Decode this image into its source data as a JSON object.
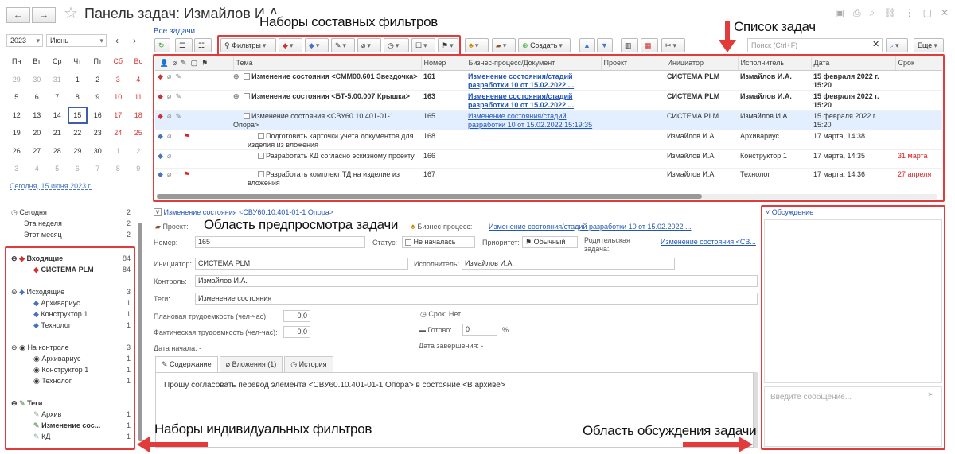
{
  "window": {
    "title": "Панель задач: Измайлов И.А."
  },
  "calendar": {
    "year": "2023",
    "month": "Июнь",
    "weekdays": [
      "Пн",
      "Вт",
      "Ср",
      "Чт",
      "Пт",
      "Сб",
      "Вс"
    ],
    "rows": [
      [
        "29",
        "30",
        "31",
        "1",
        "2",
        "3",
        "4"
      ],
      [
        "5",
        "6",
        "7",
        "8",
        "9",
        "10",
        "11"
      ],
      [
        "12",
        "13",
        "14",
        "15",
        "16",
        "17",
        "18"
      ],
      [
        "19",
        "20",
        "21",
        "22",
        "23",
        "24",
        "25"
      ],
      [
        "26",
        "27",
        "28",
        "29",
        "30",
        "1",
        "2"
      ],
      [
        "3",
        "4",
        "5",
        "6",
        "7",
        "8",
        "9"
      ]
    ],
    "today_link": "Сегодня, 15 июня 2023 г."
  },
  "filters": {
    "periods": [
      {
        "label": "Сегодня",
        "count": "2"
      },
      {
        "label": "Эта неделя",
        "count": "2"
      },
      {
        "label": "Этот месяц",
        "count": "2"
      }
    ],
    "incoming": {
      "label": "Входящие",
      "count": "84",
      "items": [
        {
          "label": "СИСТЕМА PLM",
          "count": "84"
        }
      ]
    },
    "outgoing": {
      "label": "Исходящие",
      "count": "3",
      "items": [
        {
          "label": "Архивариус",
          "count": "1"
        },
        {
          "label": "Конструктор 1",
          "count": "1"
        },
        {
          "label": "Технолог",
          "count": "1"
        }
      ]
    },
    "control": {
      "label": "На контроле",
      "count": "3",
      "items": [
        {
          "label": "Архивариус",
          "count": "1"
        },
        {
          "label": "Конструктор 1",
          "count": "1"
        },
        {
          "label": "Технолог",
          "count": "1"
        }
      ]
    },
    "tags": {
      "label": "Теги",
      "items": [
        {
          "label": "Архив",
          "count": "1"
        },
        {
          "label": "Изменение сос...",
          "count": "1"
        },
        {
          "label": "КД",
          "count": "1"
        }
      ]
    }
  },
  "toolbar": {
    "all_tasks": "Все задачи",
    "filters": "Фильтры",
    "create": "Создать",
    "search_placeholder": "Поиск (Ctrl+F)",
    "more": "Еще"
  },
  "table": {
    "columns": [
      "Тема",
      "Номер",
      "Бизнес-процесс/Документ",
      "Проект",
      "Инициатор",
      "Исполнитель",
      "Дата",
      "Срок"
    ],
    "rows": [
      {
        "topic": "Изменение состояния <СММ00.601 Звездочка>",
        "number": "161",
        "process": "Изменение состояния/стадий разработки 10 от 15.02.2022 ...",
        "initiator": "СИСТЕМА PLM",
        "executor": "Измайлов И.А.",
        "date": "15 февраля 2022 г. 15:20",
        "due": ""
      },
      {
        "topic": "Изменение состояния <БТ-5.00.007 Крышка>",
        "number": "163",
        "process": "Изменение состояния/стадий разработки 10 от 15.02.2022 ...",
        "initiator": "СИСТЕМА PLM",
        "executor": "Измайлов И.А.",
        "date": "15 февраля 2022 г. 15:20",
        "due": ""
      },
      {
        "topic": "Изменение состояния <СВУ60.10.401-01-1 Опора>",
        "number": "165",
        "process": "Изменение состояния/стадий разработки 10 от 15.02.2022 15:19:35",
        "initiator": "СИСТЕМА PLM",
        "executor": "Измайлов И.А.",
        "date": "15 февраля 2022 г. 15:20",
        "due": ""
      },
      {
        "topic": "Подготовить карточки учета документов для изделия из вложения",
        "number": "168",
        "process": "",
        "initiator": "Измайлов И.А.",
        "executor": "Архивариус",
        "date": "17 марта, 14:38",
        "due": ""
      },
      {
        "topic": "Разработать КД согласно эскизному проекту",
        "number": "166",
        "process": "",
        "initiator": "Измайлов И.А.",
        "executor": "Конструктор 1",
        "date": "17 марта, 14:35",
        "due": "31 марта"
      },
      {
        "topic": "Разработать комплект ТД на изделие из вложения",
        "number": "167",
        "process": "",
        "initiator": "Измайлов И.А.",
        "executor": "Технолог",
        "date": "17 марта, 14:36",
        "due": "27 апреля"
      }
    ]
  },
  "preview": {
    "header": "Изменение состояния <СВУ60.10.401-01-1 Опора>",
    "project_label": "Проект:",
    "process_label": "Бизнес-процесс:",
    "process_value": "Изменение состояния/стадий разработки 10 от 15.02.2022 ...",
    "number_label": "Номер:",
    "number": "165",
    "status_label": "Статус:",
    "status": "Не началась",
    "priority_label": "Приоритет:",
    "priority": "Обычный",
    "parent_label": "Родительская задача:",
    "parent_value": "Изменение состояния <СВ...",
    "initiator_label": "Инициатор:",
    "initiator": "СИСТЕМА PLM",
    "executor_label": "Исполнитель:",
    "executor": "Измайлов И.А.",
    "control_label": "Контроль:",
    "control": "Измайлов И.А.",
    "tags_label": "Теги:",
    "tags": "Изменение состояния",
    "planned_label": "Плановая трудоемкость (чел-час):",
    "planned": "0,0",
    "actual_label": "Фактическая трудоемкость (чел-час):",
    "actual": "0,0",
    "due_label": "Срок:",
    "due": "Нет",
    "ready_label": "Готово:",
    "ready": "0",
    "percent": "%",
    "start_label": "Дата начала: -",
    "end_label": "Дата завершения: -",
    "tabs": [
      "Содержание",
      "Вложения (1)",
      "История"
    ],
    "content": "Прошу согласовать перевод элемента <СВУ60.10.401-01-1 Опора> в состояние <В архиве>"
  },
  "discussion": {
    "title": "Обсуждение",
    "placeholder": "Введите сообщение..."
  },
  "annotations": {
    "composite": "Наборы составных фильтров",
    "tasklist": "Список задач",
    "preview": "Область предпросмотра задачи",
    "individual": "Наборы индивидуальных фильтров",
    "discussion": "Область обсуждения задачи"
  }
}
